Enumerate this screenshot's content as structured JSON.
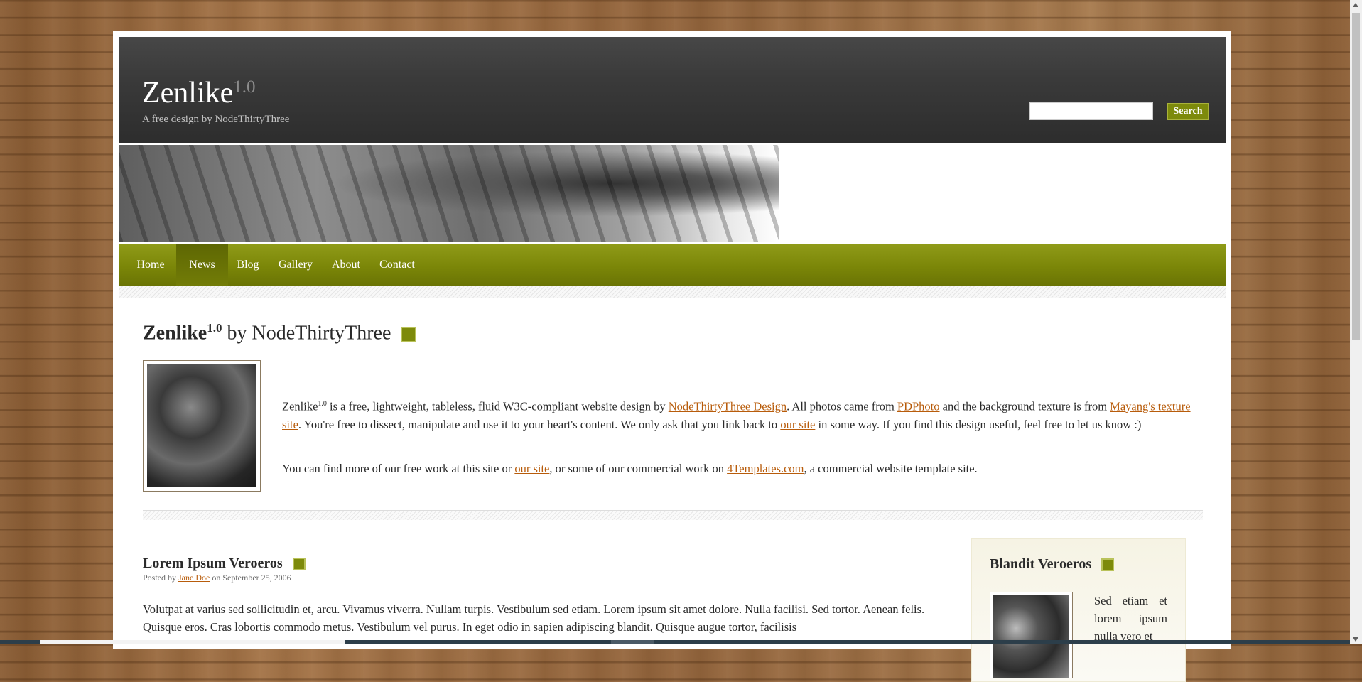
{
  "header": {
    "logo": "Zenlike",
    "logo_version": "1.0",
    "tagline": "A free design by NodeThirtyThree",
    "search_placeholder": "",
    "search_button": "Search"
  },
  "nav": {
    "items": [
      {
        "label": "Home"
      },
      {
        "label": "News"
      },
      {
        "label": "Blog"
      },
      {
        "label": "Gallery"
      },
      {
        "label": "About"
      },
      {
        "label": "Contact"
      }
    ],
    "active": "News"
  },
  "intro": {
    "title_main": "Zenlike",
    "title_version": "1.0",
    "title_rest": " by NodeThirtyThree",
    "p1": {
      "brand": "Zenlike",
      "brand_version": "1.0",
      "t1": " is a free, lightweight, tableless, fluid W3C-compliant website design by ",
      "l1": "NodeThirtyThree Design",
      "t2": ". All photos came from ",
      "l2": "PDPhoto",
      "t3": " and the background texture is from ",
      "l3": "Mayang's texture site",
      "t4": ". You're free to dissect, manipulate and use it to your heart's content. We only ask that you link back to ",
      "l4": "our site",
      "t5": " in some way. If you find this design useful, feel free to let us know :)"
    },
    "p2": {
      "t1": "You can find more of our free work at this site or ",
      "l1": "our site",
      "t2": ", or some of our commercial work on ",
      "l2": "4Templates.com",
      "t3": ", a commercial website template site."
    }
  },
  "post": {
    "title": "Lorem Ipsum Veroeros",
    "meta_prefix": "Posted by ",
    "author": "Jane Doe",
    "meta_suffix": " on September 25, 2006",
    "body": "Volutpat at varius sed sollicitudin et, arcu. Vivamus viverra. Nullam turpis. Vestibulum sed etiam. Lorem ipsum sit amet dolore. Nulla facilisi. Sed tortor. Aenean felis. Quisque eros. Cras lobortis commodo metus. Vestibulum vel purus. In eget odio in sapien adipiscing blandit. Quisque augue tortor, facilisis"
  },
  "sidebar": {
    "title": "Blandit Veroeros",
    "text": "Sed etiam et lorem ipsum nulla vero et"
  },
  "colors": {
    "accent_green": "#7d8a0b",
    "header_dark": "#2d2d2d",
    "link": "#b85c0b"
  }
}
